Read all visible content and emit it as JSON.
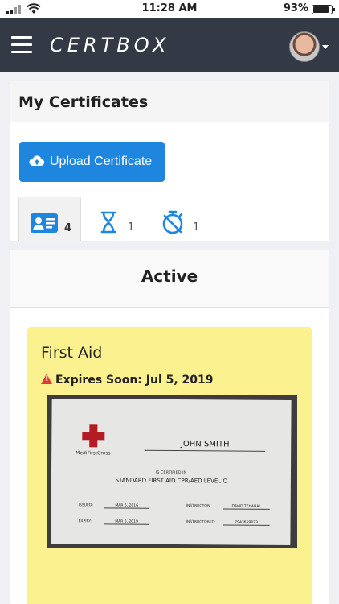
{
  "status_bar": {
    "time": "11:28 AM",
    "battery": "93%"
  },
  "navbar": {
    "brand": "CERTBOX"
  },
  "certificates_card": {
    "title": "My Certificates",
    "upload_label": "Upload Certificate",
    "tabs": [
      {
        "icon": "id-card-icon",
        "count": "4"
      },
      {
        "icon": "hourglass-icon",
        "count": "1"
      },
      {
        "icon": "stopwatch-off-icon",
        "count": "1"
      }
    ]
  },
  "active_section": {
    "title": "Active",
    "certificate": {
      "title": "First Aid",
      "expires_text": "Expires Soon: Jul 5, 2019",
      "image": {
        "org": "MediFirstCross",
        "holder": "JOHN SMITH",
        "certified_in": "IS CERTIFIED IN",
        "course": "STANDARD FIRST AID CPR/AED LEVEL C",
        "issued_label": "ISSUED:",
        "issued_value": "MAR 5, 2016",
        "expiry_label": "EXPIRY:",
        "expiry_value": "MAR 5, 2019",
        "instructor_label": "INSTRUCTOR:",
        "instructor_value": "DAVID TEHANAL",
        "instructor_id_label": "INSTRUCTOR ID:",
        "instructor_id_value": "7943659873"
      }
    }
  },
  "colors": {
    "navbar": "#343a45",
    "accent": "#1f86e0",
    "certificate_bg": "#fbf28f",
    "warning": "#e03b2f"
  }
}
